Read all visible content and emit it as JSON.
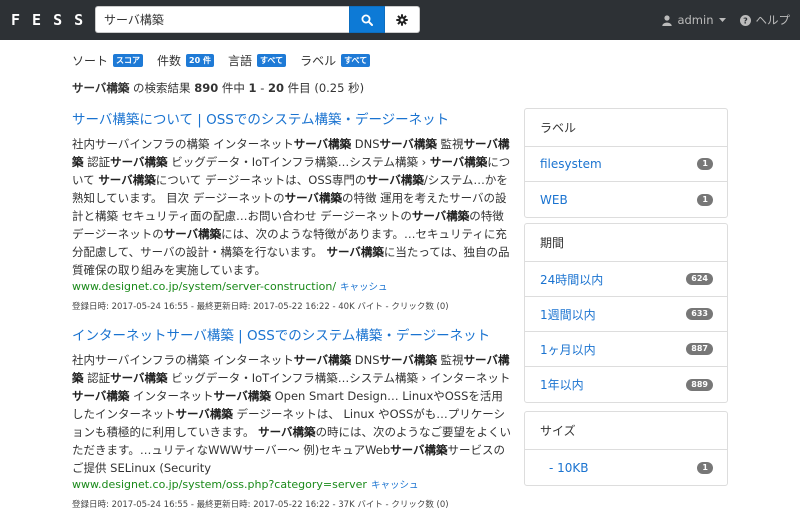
{
  "app": {
    "logo_letters": [
      "F",
      "E",
      "S",
      "S"
    ]
  },
  "search": {
    "value": "サーバ構築"
  },
  "nav": {
    "user": "admin",
    "help": "ヘルプ"
  },
  "filters": [
    {
      "label": "ソート",
      "value": "スコア"
    },
    {
      "label": "件数",
      "value": "20 件"
    },
    {
      "label": "言語",
      "value": "すべて"
    },
    {
      "label": "ラベル",
      "value": "すべて"
    }
  ],
  "summary": {
    "query": "サーバ構築",
    "t1": " の検索結果 ",
    "total": "890",
    "t2": " 件中 ",
    "start": "1",
    "t3": " - ",
    "end": "20",
    "t4": " 件目 (0.25 秒)"
  },
  "results": [
    {
      "title": "サーバ構築について | OSSでのシステム構築・デージーネット",
      "url": "www.designet.co.jp/system/server-construction/",
      "cache": "キャッシュ",
      "meta": "登録日時: 2017-05-24 16:55 - 最終更新日時: 2017-05-22 16:22 - 40K バイト - クリック数 (0)"
    },
    {
      "title": "インターネットサーバ構築 | OSSでのシステム構築・デージーネット",
      "url": "www.designet.co.jp/system/oss.php?category=server",
      "cache": "キャッシュ",
      "meta": "登録日時: 2017-05-24 16:55 - 最終更新日時: 2017-05-22 16:22 - 37K バイト - クリック数 (0)"
    }
  ],
  "sidebar": {
    "label": {
      "title": "ラベル",
      "items": [
        {
          "name": "filesystem",
          "count": "1"
        },
        {
          "name": "WEB",
          "count": "1"
        }
      ]
    },
    "period": {
      "title": "期間",
      "items": [
        {
          "name": "24時間以内",
          "count": "624"
        },
        {
          "name": "1週間以内",
          "count": "633"
        },
        {
          "name": "1ヶ月以内",
          "count": "887"
        },
        {
          "name": "1年以内",
          "count": "889"
        }
      ]
    },
    "size": {
      "title": "サイズ",
      "items": [
        {
          "name": "- 10KB",
          "count": "1"
        }
      ]
    }
  },
  "colors": {
    "navbar": "#2d3135",
    "primary": "#0d7ad6",
    "link": "#1a73d0",
    "url": "#1a8a1a"
  }
}
